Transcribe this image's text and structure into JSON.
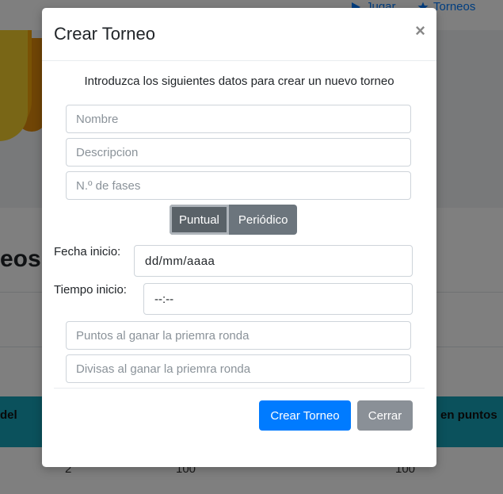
{
  "background": {
    "nav": {
      "items": [
        {
          "label": "Jugar",
          "icon": "play-icon"
        },
        {
          "label": "Torneos",
          "icon": "star-icon"
        }
      ]
    },
    "title_fragment": "eos",
    "table": {
      "headers": [
        "del",
        "en puntos"
      ],
      "row": [
        "2",
        "100",
        "100"
      ]
    }
  },
  "modal": {
    "title": "Crear Torneo",
    "close_symbol": "×",
    "intro": "Introduzca los siguientes datos para crear un nuevo torneo",
    "fields": {
      "nombre_placeholder": "Nombre",
      "descripcion_placeholder": "Descripcion",
      "fases_placeholder": "N.º de fases",
      "puntos_placeholder": "Puntos al ganar la priemra ronda",
      "divisas_placeholder": "Divisas al ganar la priemra ronda"
    },
    "type_toggle": {
      "options": [
        "Puntual",
        "Periódico"
      ],
      "selected": "Puntual"
    },
    "fecha_inicio": {
      "label": "Fecha inicio:",
      "value": "dd/mm/aaaa"
    },
    "tiempo_inicio": {
      "label": "Tiempo inicio:",
      "value": "--:--"
    },
    "buttons": {
      "create": "Crear Torneo",
      "close": "Cerrar"
    }
  },
  "colors": {
    "primary": "#007bff",
    "secondary": "#6c757d",
    "table_header": "#17a2b8",
    "backdrop": "rgba(0,0,0,0.5)"
  }
}
